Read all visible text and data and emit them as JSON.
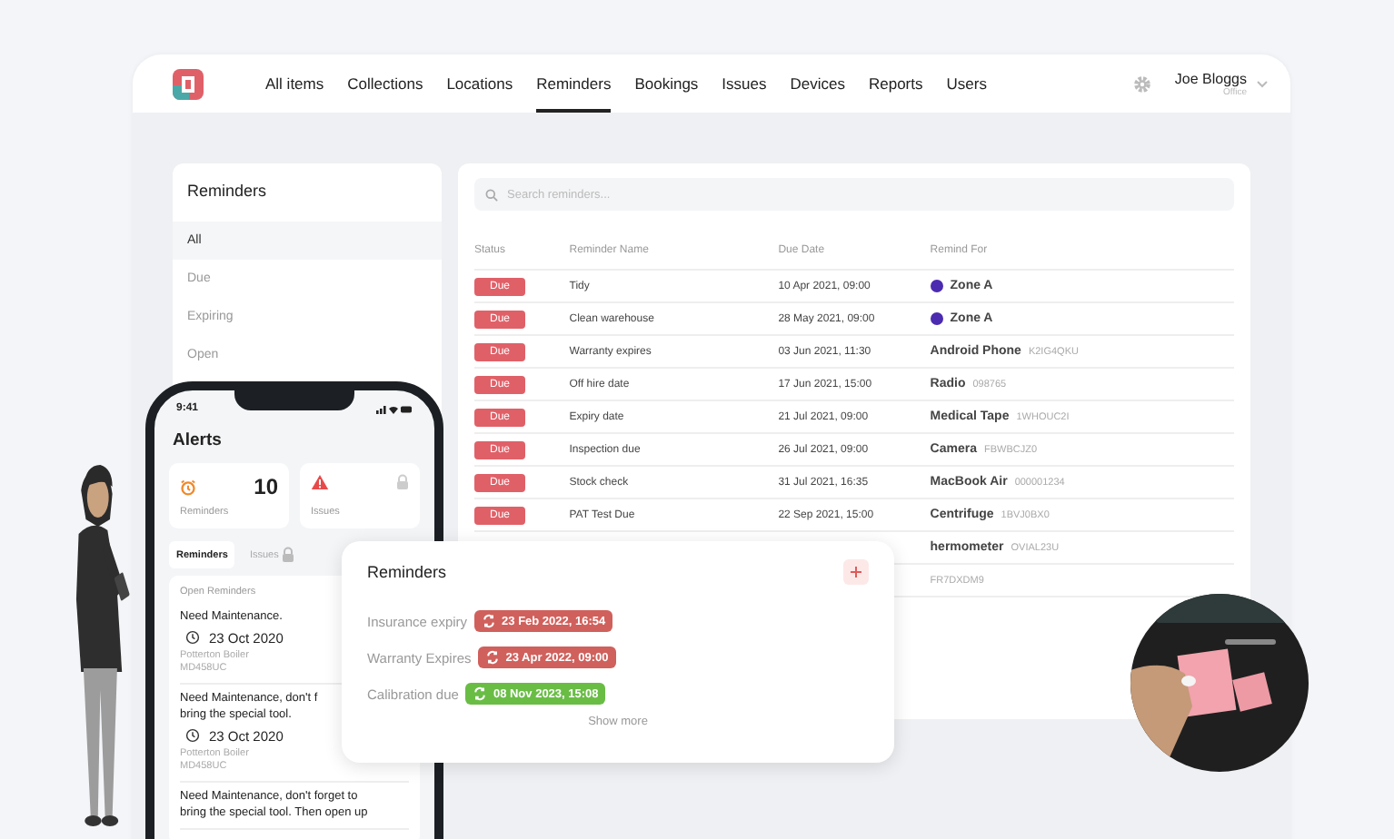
{
  "nav": {
    "items": [
      {
        "label": "All items",
        "selected": false
      },
      {
        "label": "Collections",
        "selected": false
      },
      {
        "label": "Locations",
        "selected": false
      },
      {
        "label": "Reminders",
        "selected": true
      },
      {
        "label": "Bookings",
        "selected": false
      },
      {
        "label": "Issues",
        "selected": false
      },
      {
        "label": "Devices",
        "selected": false
      },
      {
        "label": "Reports",
        "selected": false
      },
      {
        "label": "Users",
        "selected": false
      }
    ],
    "user": {
      "name": "Joe Bloggs",
      "role": "Office"
    }
  },
  "sidebar": {
    "title": "Reminders",
    "filters": [
      {
        "label": "All",
        "selected": true
      },
      {
        "label": "Due",
        "selected": false
      },
      {
        "label": "Expiring",
        "selected": false
      },
      {
        "label": "Open",
        "selected": false
      }
    ]
  },
  "search": {
    "placeholder": "Search reminders..."
  },
  "table": {
    "columns": [
      "Status",
      "Reminder Name",
      "Due Date",
      "Remind For"
    ],
    "rows": [
      {
        "status": "Due",
        "name": "Tidy",
        "due": "10 Apr 2021, 09:00",
        "remind_for": {
          "kind": "location",
          "name": "Zone A",
          "color": "#4b2bb0"
        }
      },
      {
        "status": "Due",
        "name": "Clean warehouse",
        "due": "28 May 2021, 09:00",
        "remind_for": {
          "kind": "location",
          "name": "Zone A",
          "color": "#4b2bb0"
        }
      },
      {
        "status": "Due",
        "name": "Warranty expires",
        "due": "03 Jun 2021, 11:30",
        "remind_for": {
          "kind": "item",
          "name": "Android Phone",
          "code": "K2IG4QKU"
        }
      },
      {
        "status": "Due",
        "name": "Off hire date",
        "due": "17 Jun 2021, 15:00",
        "remind_for": {
          "kind": "item",
          "name": "Radio",
          "code": "098765"
        }
      },
      {
        "status": "Due",
        "name": "Expiry date",
        "due": "21 Jul 2021, 09:00",
        "remind_for": {
          "kind": "item",
          "name": "Medical Tape",
          "code": "1WHOUC2I"
        }
      },
      {
        "status": "Due",
        "name": "Inspection due",
        "due": "26 Jul 2021, 09:00",
        "remind_for": {
          "kind": "item",
          "name": "Camera",
          "code": "FBWBCJZ0"
        }
      },
      {
        "status": "Due",
        "name": "Stock check",
        "due": "31 Jul 2021, 16:35",
        "remind_for": {
          "kind": "item",
          "name": "MacBook Air",
          "code": "000001234"
        }
      },
      {
        "status": "Due",
        "name": "PAT Test Due",
        "due": "22 Sep 2021, 15:00",
        "remind_for": {
          "kind": "item",
          "name": "Centrifuge",
          "code": "1BVJ0BX0"
        }
      },
      {
        "remind_for": {
          "kind": "item",
          "name": "hermometer",
          "code": "OVIAL23U"
        }
      },
      {
        "remind_for": {
          "kind": "item",
          "code": "FR7DXDM9"
        }
      }
    ]
  },
  "phone": {
    "time": "9:41",
    "title": "Alerts",
    "cards": [
      {
        "kind": "reminders",
        "label": "Reminders",
        "count": "10"
      },
      {
        "kind": "issues",
        "label": "Issues"
      }
    ],
    "tabs": [
      {
        "label": "Reminders",
        "selected": true,
        "locked": false
      },
      {
        "label": "Issues",
        "selected": false,
        "locked": true
      }
    ],
    "section": "Open Reminders",
    "items": [
      {
        "title": "Need Maintenance.",
        "date": "23 Oct 2020",
        "asset": "Potterton Boiler",
        "code": "MD458UC"
      },
      {
        "title": "Need Maintenance, don't f\nbring the special tool.",
        "date": "23 Oct 2020",
        "asset": "Potterton Boiler",
        "code": "MD458UC"
      },
      {
        "title": "Need Maintenance, don't forget to\nbring the special tool. Then open up"
      }
    ]
  },
  "popup": {
    "title": "Reminders",
    "rows": [
      {
        "label": "Insurance expiry",
        "date": "23 Feb 2022, 16:54",
        "color": "#d0605c"
      },
      {
        "label": "Warranty Expires",
        "date": "23 Apr 2022, 09:00",
        "color": "#d0605c"
      },
      {
        "label": "Calibration due",
        "date": "08 Nov 2023, 15:08",
        "color": "#69bd45"
      }
    ],
    "more": "Show more"
  }
}
